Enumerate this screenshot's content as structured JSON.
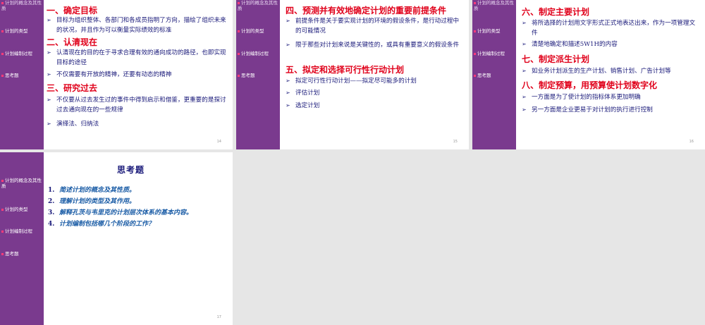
{
  "nav": {
    "item1": "计划的概念及其性质",
    "item2": "计划的类型",
    "item3": "计划编制过程",
    "item4": "思考题"
  },
  "slide14": {
    "h1": "一、确定目标",
    "b1": "目标为组织整体、各部门和各成员指明了方向，描绘了组织未来的状况，并且作为可以衡量实际绩效的标准",
    "h2": "二、认清现在",
    "b2": "认清现在的目的在于寻求合理有效的通向成功的路径，也即实现目标的途径",
    "b3": "不仅需要有开放的精神，还要有动态的精神",
    "h3": "三、研究过去",
    "b4": "不仅要从过去发生过的事件中得到启示和借鉴，更重要的是探讨过去通向现在的一些规律",
    "b5": "演绎法、归纳法",
    "page": "14"
  },
  "slide15": {
    "h1": "四、预测并有效地确定计划的重要前提条件",
    "b1": "前提条件是关于要实现计划的环境的假设条件，是行动过程中的可能情况",
    "b2": "限于那些对计划来说是关键性的，或具有重要意义的假设条件",
    "h2": "五、拟定和选择可行性行动计划",
    "b3": "拟定可行性行动计划——拟定尽可能多的计划",
    "b4": "评估计划",
    "b5": "选定计划",
    "page": "15"
  },
  "slide16": {
    "h1": "六、制定主要计划",
    "b1": "将所选择的计划用文字形式正式地表达出来，作为一项管理文件",
    "b2": "清楚地确定和描述5W1H的内容",
    "h2": "七、制定派生计划",
    "b3": "如业务计划派生的生产计划、销售计划、广告计划等",
    "h3": "八、制定预算，用预算使计划数字化",
    "b4": "一方面是为了使计划的指标体系更加明确",
    "b5": "另一方面是企业更易于对计划的执行进行控制",
    "page": "16"
  },
  "slide17": {
    "title": "思考题",
    "q1n": "1.",
    "q1": "简述计划的概念及其性质。",
    "q2n": "2.",
    "q2": "理解计划的类型及其作用。",
    "q3n": "3.",
    "q3": "解释孔茨与韦里克的计划层次体系的基本内容。",
    "q4n": "4.",
    "q4": "计划编制包括哪几个阶段的工作？",
    "page": "17"
  },
  "symbols": {
    "arrow": "➢"
  },
  "colors": {
    "sidebar": "#7a3a8e",
    "heading": "#e0001a",
    "body": "#1a1a7a",
    "question": "#1a5ca6"
  }
}
